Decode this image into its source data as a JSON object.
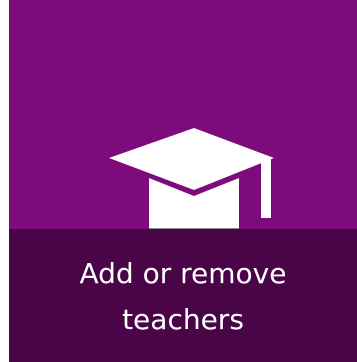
{
  "tile": {
    "label_line1": "Add or remove",
    "label_line2": "teachers",
    "icon": "graduation-cap-icon",
    "colors": {
      "background": "#7d0b7b",
      "label_band": "#4a0548",
      "icon": "#ffffff",
      "text": "#ffffff"
    }
  }
}
